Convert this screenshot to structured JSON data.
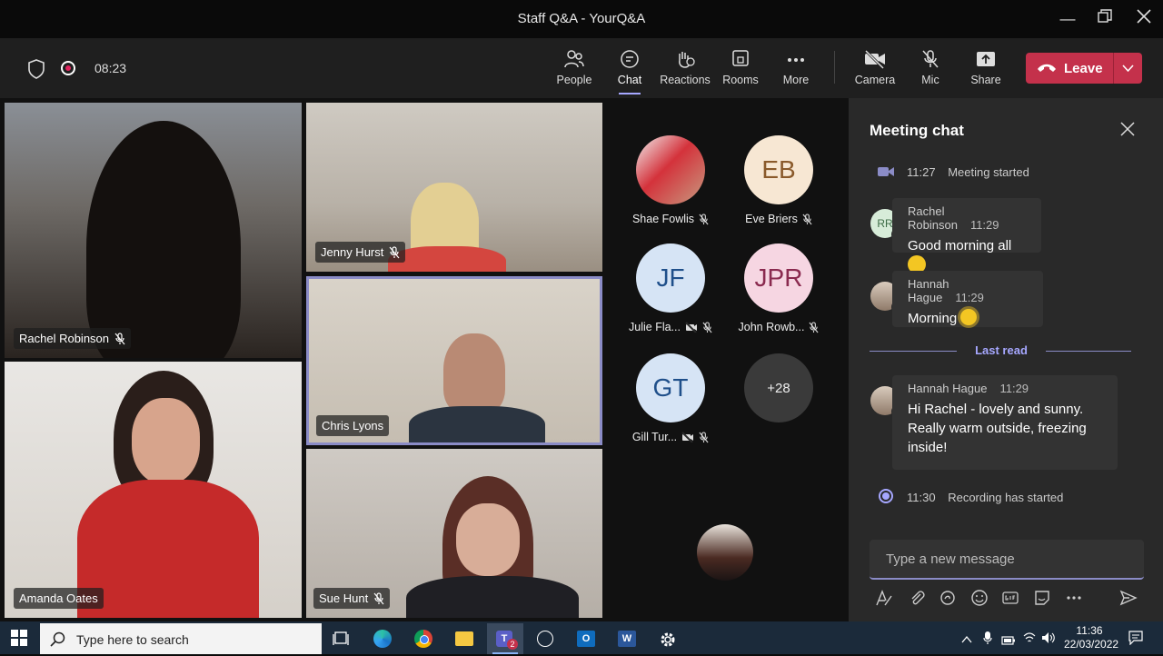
{
  "window": {
    "title": "Staff Q&A - YourQ&A"
  },
  "toolbar": {
    "timer": "08:23",
    "buttons": [
      {
        "label": "People"
      },
      {
        "label": "Chat"
      },
      {
        "label": "Reactions"
      },
      {
        "label": "Rooms"
      },
      {
        "label": "More"
      },
      {
        "label": "Camera"
      },
      {
        "label": "Mic"
      },
      {
        "label": "Share"
      }
    ],
    "leave_label": "Leave"
  },
  "video_tiles": [
    {
      "name": "Rachel Robinson",
      "muted": true
    },
    {
      "name": "Jenny Hurst",
      "muted": true
    },
    {
      "name": "Chris Lyons",
      "muted": false
    },
    {
      "name": "Amanda Oates",
      "muted": false
    },
    {
      "name": "Sue Hunt",
      "muted": true
    }
  ],
  "roster": [
    {
      "initials": "",
      "name": "Shae Fowlis"
    },
    {
      "initials": "EB",
      "name": "Eve Briers"
    },
    {
      "initials": "JF",
      "name": "Julie Fla..."
    },
    {
      "initials": "JPR",
      "name": "John Rowb..."
    },
    {
      "initials": "GT",
      "name": "Gill Tur..."
    },
    {
      "initials": "+28",
      "name": ""
    }
  ],
  "chat": {
    "title": "Meeting chat",
    "events": [
      {
        "time": "11:27",
        "text": "Meeting started"
      },
      {
        "time": "11:30",
        "text": "Recording has started"
      }
    ],
    "messages": [
      {
        "initials": "RR",
        "author": "Rachel Robinson",
        "time": "11:29",
        "text": "Good morning all"
      },
      {
        "author": "Hannah Hague",
        "time": "11:29",
        "text": "Morning"
      },
      {
        "author": "Hannah Hague",
        "time": "11:29",
        "text": "Hi Rachel - lovely and sunny. Really warm outside, freezing inside!"
      }
    ],
    "last_read_label": "Last read",
    "compose_placeholder": "Type a new message"
  },
  "taskbar": {
    "search_placeholder": "Type here to search",
    "time": "11:36",
    "date": "22/03/2022",
    "teams_badge": "2"
  },
  "colors": {
    "accent": "#a6a7ff",
    "leave": "#c4314b",
    "presence": "#c4314b"
  }
}
